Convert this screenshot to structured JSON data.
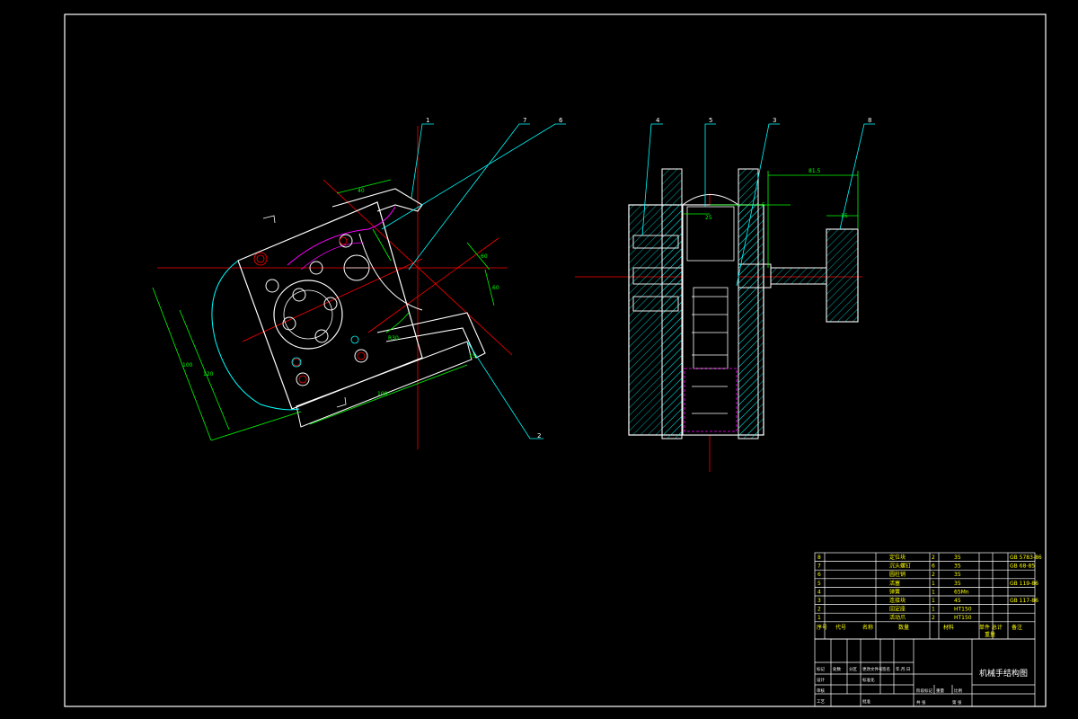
{
  "drawing": {
    "title": "机械手结构图",
    "balloons": [
      "1",
      "7",
      "6",
      "4",
      "5",
      "3",
      "8",
      "2"
    ],
    "dimensions": {
      "d_top": "40",
      "d_right_a": "60",
      "d_right_b": "60",
      "d_left_a": "100",
      "d_left_b": "120",
      "d_bottom": "100",
      "d_slot": "15",
      "d_arc": "R30",
      "s_top": "81.5",
      "s_mid": "25",
      "s_small": "5",
      "s_r": "15"
    },
    "colors": {
      "background": "#000000",
      "border": "#ffffff",
      "leader": "#00ffff",
      "centerline": "#ff0000",
      "dimension": "#00ff00",
      "hatch": "#00ffff",
      "magenta": "#ff00ff",
      "table_text": "#ffff00"
    }
  },
  "parts_list": {
    "rows": [
      {
        "no": "8",
        "name": "定位块",
        "qty": "2",
        "material": "35",
        "standard": "GB 5783-86"
      },
      {
        "no": "7",
        "name": "沉头螺钉",
        "qty": "6",
        "material": "35",
        "standard": "GB 68-85"
      },
      {
        "no": "6",
        "name": "圆柱销",
        "qty": "2",
        "material": "35",
        "standard": ""
      },
      {
        "no": "5",
        "name": "活塞",
        "qty": "1",
        "material": "35",
        "standard": "GB 119-86"
      },
      {
        "no": "4",
        "name": "弹簧",
        "qty": "1",
        "material": "65Mn",
        "standard": ""
      },
      {
        "no": "3",
        "name": "连接块",
        "qty": "1",
        "material": "45",
        "standard": "GB 117-86"
      },
      {
        "no": "2",
        "name": "固定座",
        "qty": "1",
        "material": "HT150",
        "standard": ""
      },
      {
        "no": "1",
        "name": "活动爪",
        "qty": "2",
        "material": "HT150",
        "standard": ""
      }
    ],
    "header": [
      "序号",
      "代号",
      "名称",
      "数量",
      "材料",
      "单件 总计",
      "备注"
    ],
    "header_weight": "重量"
  },
  "title_block": {
    "drawing_name": "机械手结构图",
    "cells": [
      "标记",
      "处数",
      "分区",
      "更改文件号",
      "签名",
      "年.月.日",
      "设计",
      "标准化",
      "阶段标记",
      "重量",
      "比例",
      "审核",
      "工艺",
      "批准",
      "共 张",
      "第 张"
    ]
  }
}
